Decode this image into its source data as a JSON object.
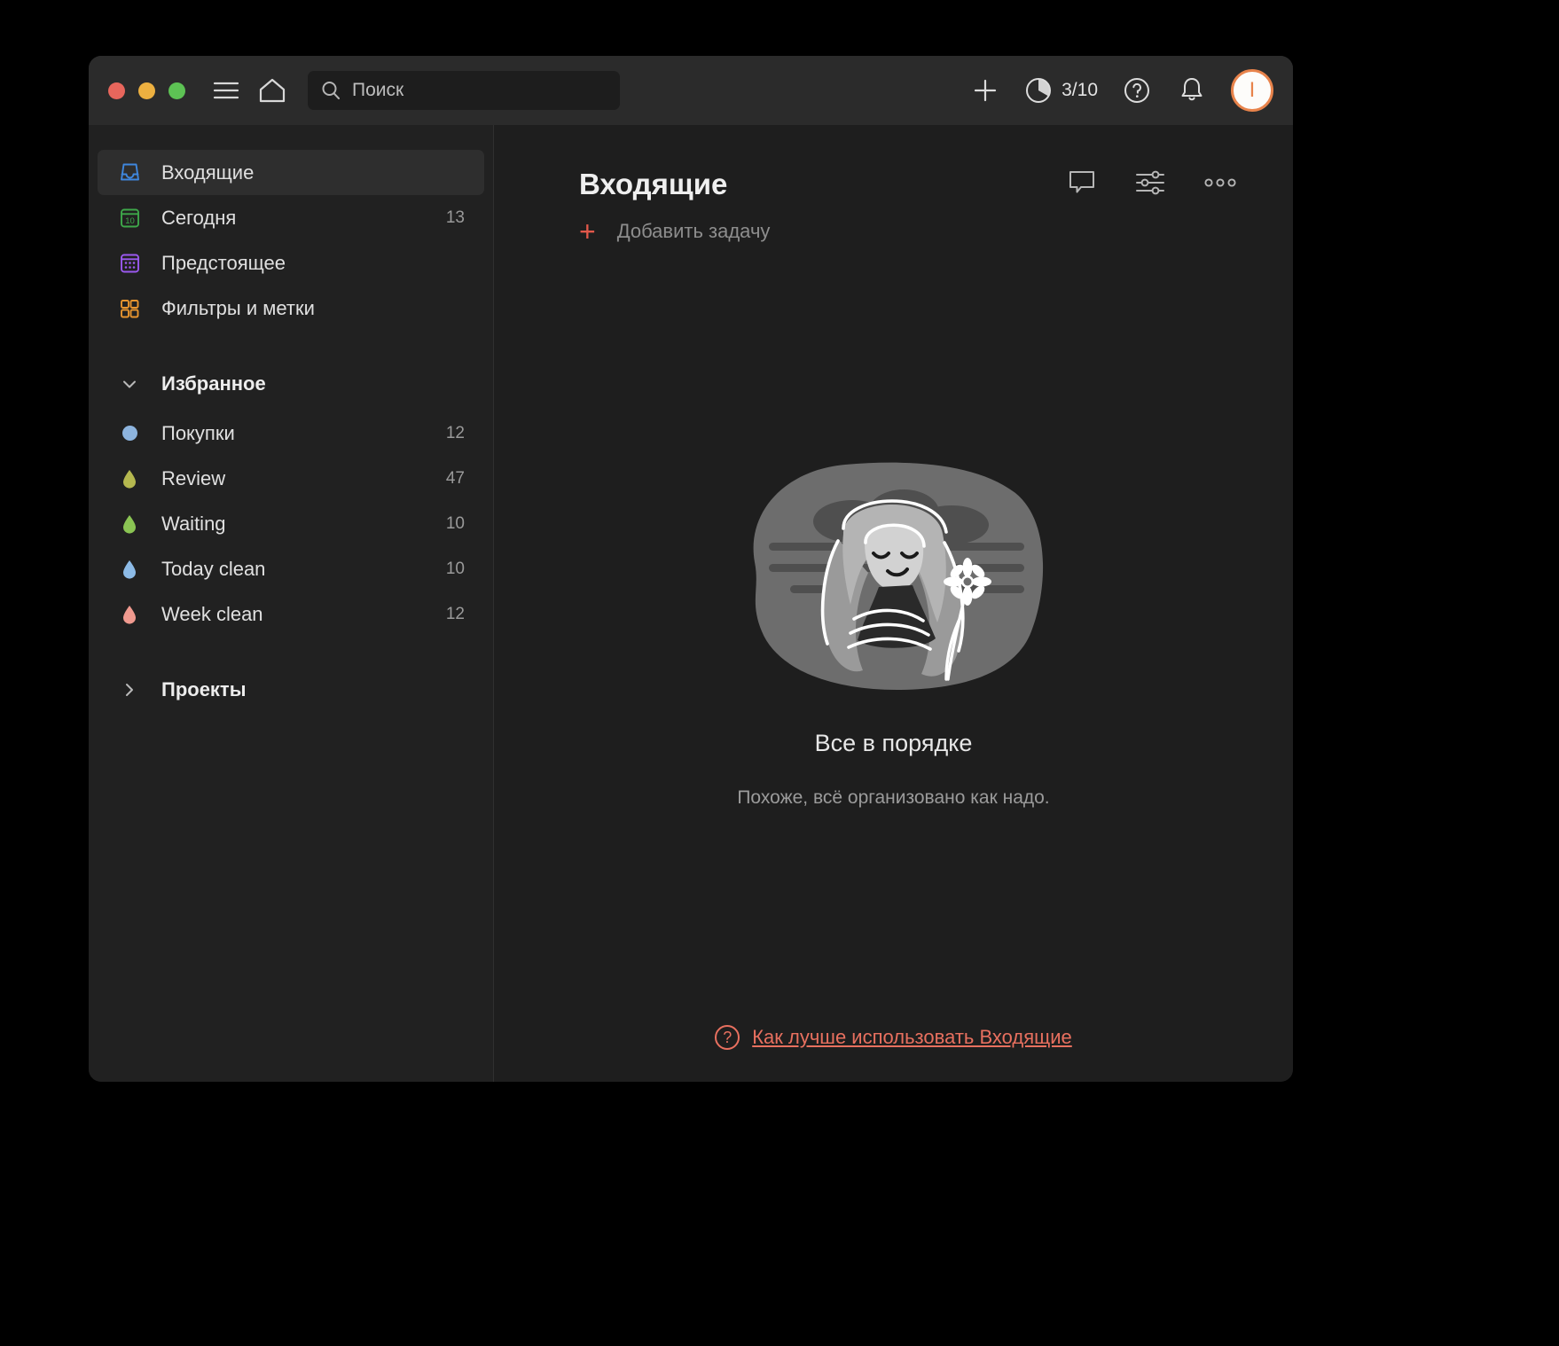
{
  "titlebar": {
    "window_controls": [
      "close",
      "minimize",
      "zoom"
    ],
    "menu_icon": "hamburger-icon",
    "home_icon": "home-icon",
    "search": {
      "placeholder": "Поиск",
      "value": ""
    },
    "add_label": "+",
    "karma": {
      "value": "3/10",
      "icon": "pie-progress-icon"
    },
    "help_icon": "question-circle-icon",
    "notifications_icon": "bell-icon",
    "avatar": {
      "initial": "I",
      "ring_color": "#e8834b"
    }
  },
  "sidebar": {
    "nav": [
      {
        "label": "Входящие",
        "count": "",
        "icon": "inbox-icon",
        "color": "#3f87de",
        "active": true
      },
      {
        "label": "Сегодня",
        "count": "13",
        "icon": "calendar-today-icon",
        "color": "#3ea84a",
        "day": "10",
        "active": false
      },
      {
        "label": "Предстоящее",
        "count": "",
        "icon": "calendar-grid-icon",
        "color": "#9b59f0",
        "active": false
      },
      {
        "label": "Фильтры и метки",
        "count": "",
        "icon": "filters-labels-icon",
        "color": "#e8952f",
        "active": false
      }
    ],
    "favorites": {
      "title": "Избранное",
      "expanded": true,
      "chevron": "chevron-down-icon",
      "items": [
        {
          "label": "Покупки",
          "count": "12",
          "shape": "circle",
          "color": "#8db4de"
        },
        {
          "label": "Review",
          "count": "47",
          "shape": "droplet",
          "color": "#b5b84f"
        },
        {
          "label": "Waiting",
          "count": "10",
          "shape": "droplet",
          "color": "#8ac453"
        },
        {
          "label": "Today clean",
          "count": "10",
          "shape": "droplet",
          "color": "#8dbbe7"
        },
        {
          "label": "Week clean",
          "count": "12",
          "shape": "droplet",
          "color": "#f09a8f"
        }
      ]
    },
    "projects": {
      "title": "Проекты",
      "expanded": false,
      "chevron": "chevron-right-icon"
    }
  },
  "main": {
    "title": "Входящие",
    "actions": [
      {
        "name": "comments",
        "icon": "comment-bubble-icon"
      },
      {
        "name": "view-options",
        "icon": "sliders-icon"
      },
      {
        "name": "more-menu",
        "icon": "more-horizontal-icon"
      }
    ],
    "add_task_label": "Добавить задачу",
    "empty_state": {
      "illustration": "woman-with-flower-illustration",
      "title": "Все в порядке",
      "subtitle": "Похоже, всё организовано как надо."
    },
    "footer": {
      "icon": "question-circle-icon",
      "link_text": "Как лучше использовать Входящие",
      "color": "#e8705f"
    }
  }
}
